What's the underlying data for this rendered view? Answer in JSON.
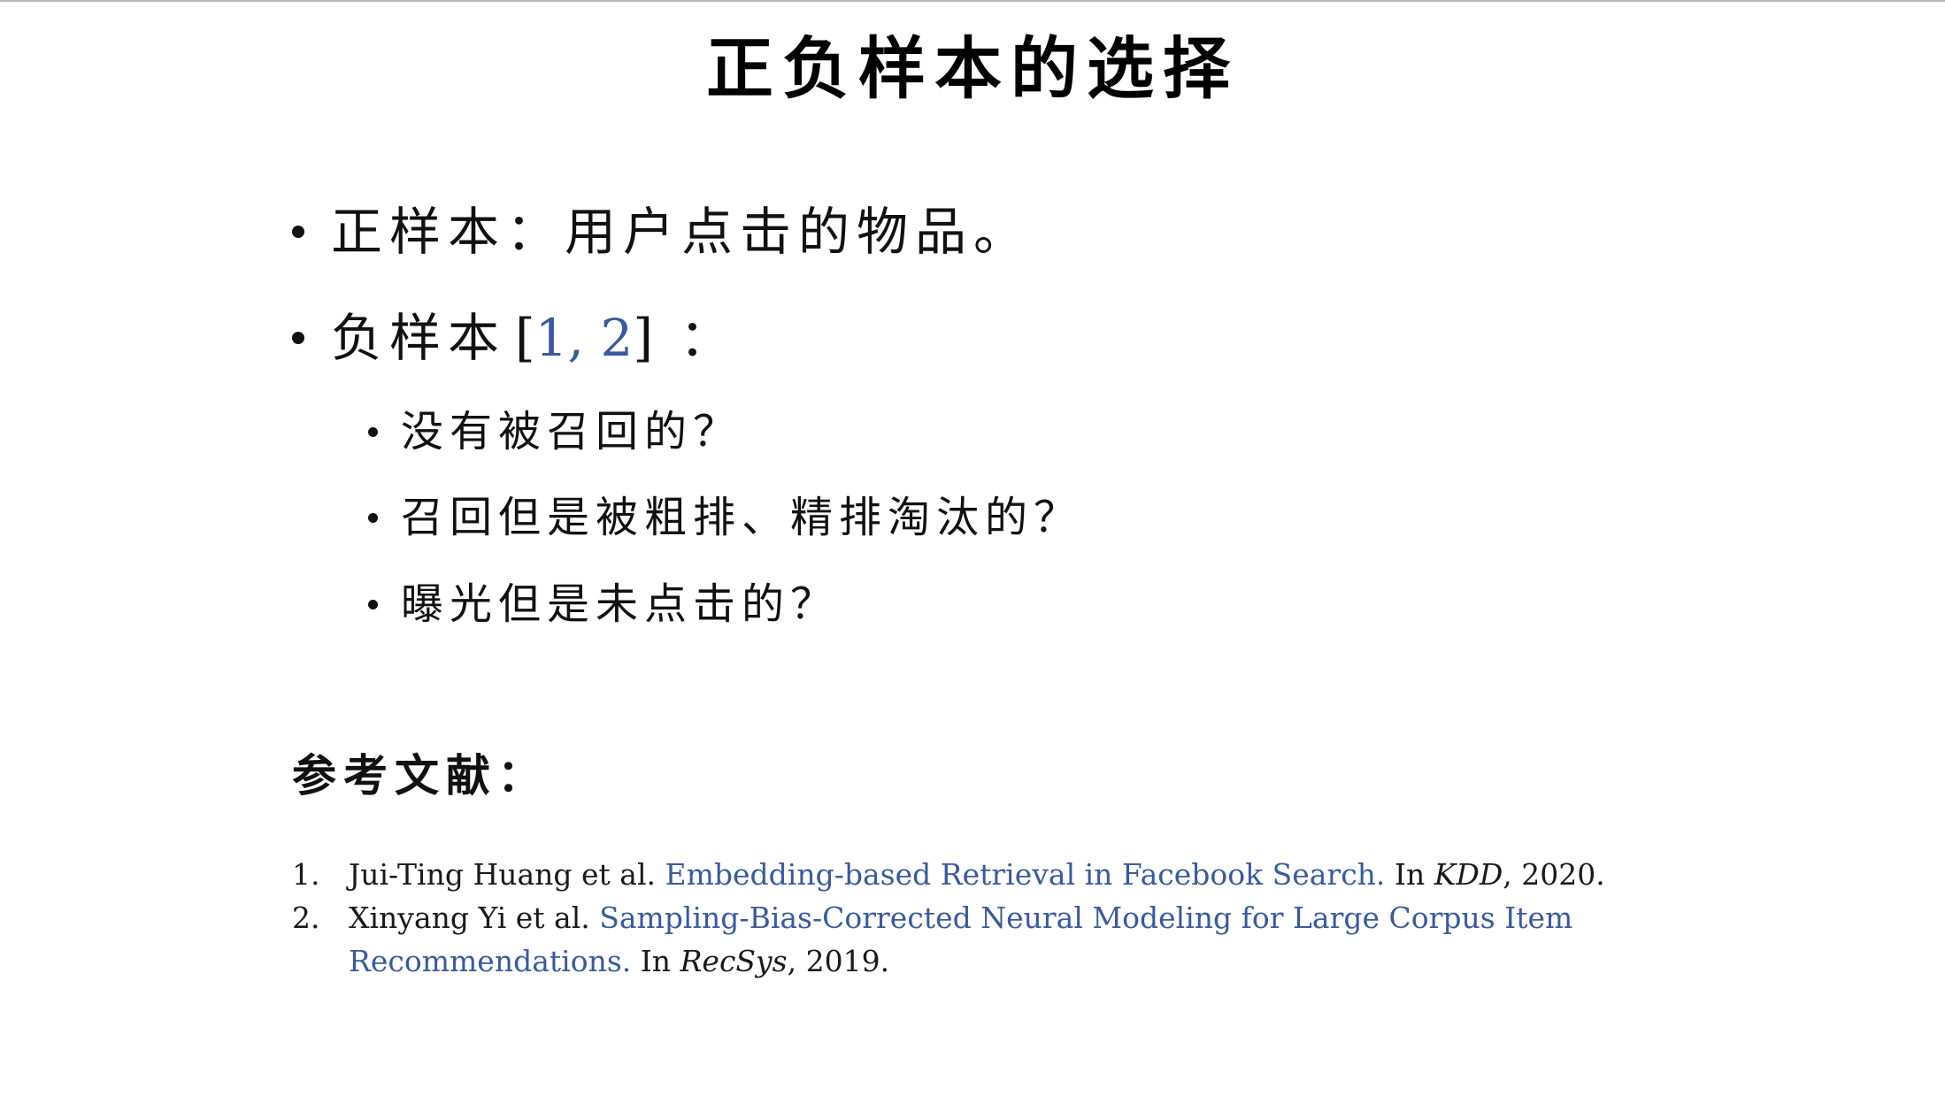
{
  "slide": {
    "title": "正负样本的选择"
  },
  "bullets": {
    "positive": {
      "text": "正样本：用户点击的物品。"
    },
    "negative": {
      "label": "负样本",
      "cite_open": "[",
      "cite_text": "1, 2",
      "cite_close": "]",
      "suffix": "：",
      "sub_items": [
        "没有被召回的？",
        "召回但是被粗排、精排淘汰的？",
        "曝光但是未点击的？"
      ]
    }
  },
  "references": {
    "heading": "参考文献：",
    "items": [
      {
        "num": "1.",
        "authors": "Jui-Ting Huang et al.",
        "title": "Embedding-based Retrieval in Facebook Search.",
        "in": "In",
        "venue": "KDD",
        "year": ", 2020."
      },
      {
        "num": "2.",
        "authors": "Xinyang Yi et al.",
        "title_line1": "Sampling-Bias-Corrected Neural Modeling for Large Corpus Item",
        "title_line2": "Recommendations.",
        "in": "In",
        "venue": "RecSys",
        "year": ", 2019."
      }
    ]
  },
  "colors": {
    "link": "#3a5a9c",
    "text": "#111111",
    "background": "#ffffff"
  }
}
